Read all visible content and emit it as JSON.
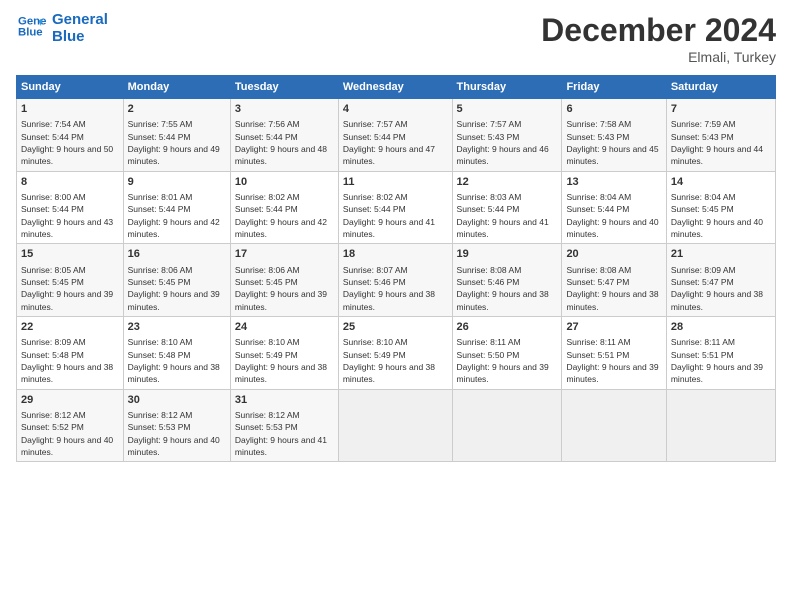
{
  "logo": {
    "line1": "General",
    "line2": "Blue"
  },
  "title": "December 2024",
  "subtitle": "Elmali, Turkey",
  "days_of_week": [
    "Sunday",
    "Monday",
    "Tuesday",
    "Wednesday",
    "Thursday",
    "Friday",
    "Saturday"
  ],
  "weeks": [
    [
      {
        "day": "1",
        "sunrise": "Sunrise: 7:54 AM",
        "sunset": "Sunset: 5:44 PM",
        "daylight": "Daylight: 9 hours and 50 minutes."
      },
      {
        "day": "2",
        "sunrise": "Sunrise: 7:55 AM",
        "sunset": "Sunset: 5:44 PM",
        "daylight": "Daylight: 9 hours and 49 minutes."
      },
      {
        "day": "3",
        "sunrise": "Sunrise: 7:56 AM",
        "sunset": "Sunset: 5:44 PM",
        "daylight": "Daylight: 9 hours and 48 minutes."
      },
      {
        "day": "4",
        "sunrise": "Sunrise: 7:57 AM",
        "sunset": "Sunset: 5:44 PM",
        "daylight": "Daylight: 9 hours and 47 minutes."
      },
      {
        "day": "5",
        "sunrise": "Sunrise: 7:57 AM",
        "sunset": "Sunset: 5:43 PM",
        "daylight": "Daylight: 9 hours and 46 minutes."
      },
      {
        "day": "6",
        "sunrise": "Sunrise: 7:58 AM",
        "sunset": "Sunset: 5:43 PM",
        "daylight": "Daylight: 9 hours and 45 minutes."
      },
      {
        "day": "7",
        "sunrise": "Sunrise: 7:59 AM",
        "sunset": "Sunset: 5:43 PM",
        "daylight": "Daylight: 9 hours and 44 minutes."
      }
    ],
    [
      {
        "day": "8",
        "sunrise": "Sunrise: 8:00 AM",
        "sunset": "Sunset: 5:44 PM",
        "daylight": "Daylight: 9 hours and 43 minutes."
      },
      {
        "day": "9",
        "sunrise": "Sunrise: 8:01 AM",
        "sunset": "Sunset: 5:44 PM",
        "daylight": "Daylight: 9 hours and 42 minutes."
      },
      {
        "day": "10",
        "sunrise": "Sunrise: 8:02 AM",
        "sunset": "Sunset: 5:44 PM",
        "daylight": "Daylight: 9 hours and 42 minutes."
      },
      {
        "day": "11",
        "sunrise": "Sunrise: 8:02 AM",
        "sunset": "Sunset: 5:44 PM",
        "daylight": "Daylight: 9 hours and 41 minutes."
      },
      {
        "day": "12",
        "sunrise": "Sunrise: 8:03 AM",
        "sunset": "Sunset: 5:44 PM",
        "daylight": "Daylight: 9 hours and 41 minutes."
      },
      {
        "day": "13",
        "sunrise": "Sunrise: 8:04 AM",
        "sunset": "Sunset: 5:44 PM",
        "daylight": "Daylight: 9 hours and 40 minutes."
      },
      {
        "day": "14",
        "sunrise": "Sunrise: 8:04 AM",
        "sunset": "Sunset: 5:45 PM",
        "daylight": "Daylight: 9 hours and 40 minutes."
      }
    ],
    [
      {
        "day": "15",
        "sunrise": "Sunrise: 8:05 AM",
        "sunset": "Sunset: 5:45 PM",
        "daylight": "Daylight: 9 hours and 39 minutes."
      },
      {
        "day": "16",
        "sunrise": "Sunrise: 8:06 AM",
        "sunset": "Sunset: 5:45 PM",
        "daylight": "Daylight: 9 hours and 39 minutes."
      },
      {
        "day": "17",
        "sunrise": "Sunrise: 8:06 AM",
        "sunset": "Sunset: 5:45 PM",
        "daylight": "Daylight: 9 hours and 39 minutes."
      },
      {
        "day": "18",
        "sunrise": "Sunrise: 8:07 AM",
        "sunset": "Sunset: 5:46 PM",
        "daylight": "Daylight: 9 hours and 38 minutes."
      },
      {
        "day": "19",
        "sunrise": "Sunrise: 8:08 AM",
        "sunset": "Sunset: 5:46 PM",
        "daylight": "Daylight: 9 hours and 38 minutes."
      },
      {
        "day": "20",
        "sunrise": "Sunrise: 8:08 AM",
        "sunset": "Sunset: 5:47 PM",
        "daylight": "Daylight: 9 hours and 38 minutes."
      },
      {
        "day": "21",
        "sunrise": "Sunrise: 8:09 AM",
        "sunset": "Sunset: 5:47 PM",
        "daylight": "Daylight: 9 hours and 38 minutes."
      }
    ],
    [
      {
        "day": "22",
        "sunrise": "Sunrise: 8:09 AM",
        "sunset": "Sunset: 5:48 PM",
        "daylight": "Daylight: 9 hours and 38 minutes."
      },
      {
        "day": "23",
        "sunrise": "Sunrise: 8:10 AM",
        "sunset": "Sunset: 5:48 PM",
        "daylight": "Daylight: 9 hours and 38 minutes."
      },
      {
        "day": "24",
        "sunrise": "Sunrise: 8:10 AM",
        "sunset": "Sunset: 5:49 PM",
        "daylight": "Daylight: 9 hours and 38 minutes."
      },
      {
        "day": "25",
        "sunrise": "Sunrise: 8:10 AM",
        "sunset": "Sunset: 5:49 PM",
        "daylight": "Daylight: 9 hours and 38 minutes."
      },
      {
        "day": "26",
        "sunrise": "Sunrise: 8:11 AM",
        "sunset": "Sunset: 5:50 PM",
        "daylight": "Daylight: 9 hours and 39 minutes."
      },
      {
        "day": "27",
        "sunrise": "Sunrise: 8:11 AM",
        "sunset": "Sunset: 5:51 PM",
        "daylight": "Daylight: 9 hours and 39 minutes."
      },
      {
        "day": "28",
        "sunrise": "Sunrise: 8:11 AM",
        "sunset": "Sunset: 5:51 PM",
        "daylight": "Daylight: 9 hours and 39 minutes."
      }
    ],
    [
      {
        "day": "29",
        "sunrise": "Sunrise: 8:12 AM",
        "sunset": "Sunset: 5:52 PM",
        "daylight": "Daylight: 9 hours and 40 minutes."
      },
      {
        "day": "30",
        "sunrise": "Sunrise: 8:12 AM",
        "sunset": "Sunset: 5:53 PM",
        "daylight": "Daylight: 9 hours and 40 minutes."
      },
      {
        "day": "31",
        "sunrise": "Sunrise: 8:12 AM",
        "sunset": "Sunset: 5:53 PM",
        "daylight": "Daylight: 9 hours and 41 minutes."
      },
      null,
      null,
      null,
      null
    ]
  ]
}
